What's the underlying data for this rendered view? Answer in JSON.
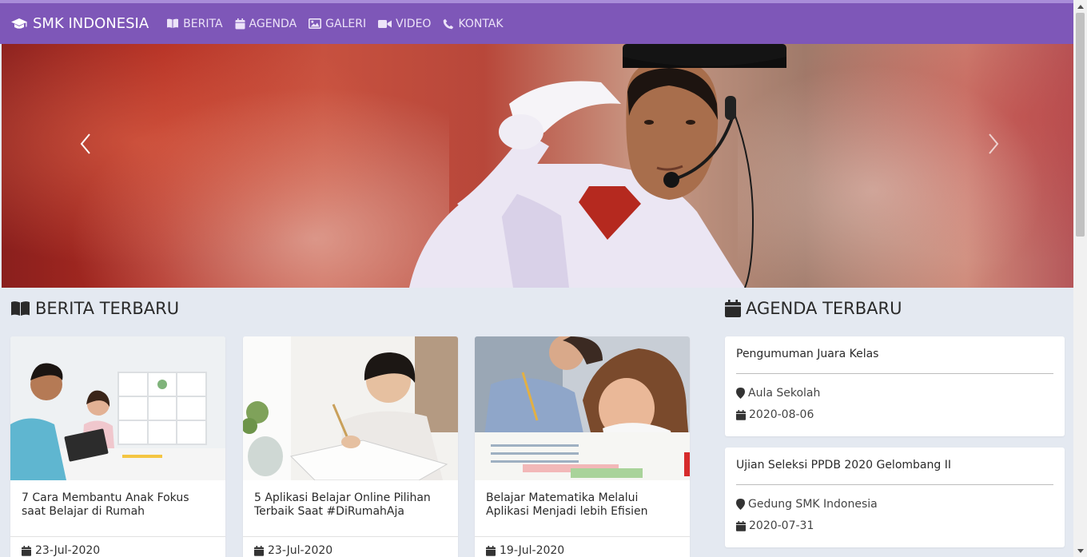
{
  "navbar": {
    "brand": "SMK INDONESIA",
    "items": [
      {
        "label": "BERITA",
        "icon": "book-icon"
      },
      {
        "label": "AGENDA",
        "icon": "calendar-icon"
      },
      {
        "label": "GALERI",
        "icon": "image-icon"
      },
      {
        "label": "VIDEO",
        "icon": "video-icon"
      },
      {
        "label": "KONTAK",
        "icon": "phone-icon"
      }
    ]
  },
  "colors": {
    "navbar": "#7e57b8",
    "background": "#e4e9f1",
    "card": "#ffffff"
  },
  "berita": {
    "title": "BERITA TERBARU",
    "items": [
      {
        "title": "7 Cara Membantu Anak Fokus saat Belajar di Rumah",
        "date": "23-Jul-2020"
      },
      {
        "title": "5 Aplikasi Belajar Online Pilihan Terbaik Saat #DiRumahAja",
        "date": "23-Jul-2020"
      },
      {
        "title": "Belajar Matematika Melalui Aplikasi Menjadi lebih Efisien",
        "date": "19-Jul-2020"
      }
    ]
  },
  "agenda": {
    "title": "AGENDA TERBARU",
    "items": [
      {
        "title": "Pengumuman Juara Kelas",
        "location": "Aula Sekolah",
        "date": "2020-08-06"
      },
      {
        "title": "Ujian Seleksi PPDB 2020 Gelombang II",
        "location": "Gedung SMK Indonesia",
        "date": "2020-07-31"
      }
    ]
  }
}
